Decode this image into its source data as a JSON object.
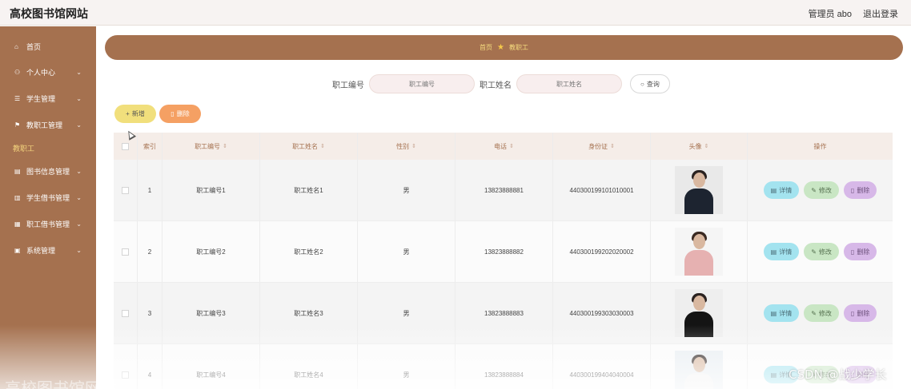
{
  "header": {
    "title": "高校图书馆网站",
    "admin_label": "管理员 abo",
    "logout_label": "退出登录"
  },
  "sidebar": {
    "items": [
      {
        "label": "首页",
        "icon": "home-icon",
        "glyph": "⌂",
        "has_chevron": false
      },
      {
        "label": "个人中心",
        "icon": "user-icon",
        "glyph": "⚇",
        "has_chevron": true
      },
      {
        "label": "学生管理",
        "icon": "student-icon",
        "glyph": "☰",
        "has_chevron": true
      },
      {
        "label": "教职工管理",
        "icon": "staff-icon",
        "glyph": "⚑",
        "has_chevron": true
      },
      {
        "label": "教职工",
        "icon": "",
        "glyph": "",
        "has_chevron": false,
        "active": true
      },
      {
        "label": "图书信息管理",
        "icon": "book-icon",
        "glyph": "▤",
        "has_chevron": true
      },
      {
        "label": "学生借书管理",
        "icon": "bar-chart-icon",
        "glyph": "▥",
        "has_chevron": true
      },
      {
        "label": "职工借书管理",
        "icon": "grid-icon",
        "glyph": "▦",
        "has_chevron": true
      },
      {
        "label": "系统管理",
        "icon": "settings-icon",
        "glyph": "▣",
        "has_chevron": true
      }
    ]
  },
  "breadcrumb": {
    "home": "首页",
    "current": "教职工"
  },
  "search": {
    "field1_label": "职工编号",
    "field1_placeholder": "职工编号",
    "field2_label": "职工姓名",
    "field2_placeholder": "职工姓名",
    "query_label": "查询"
  },
  "toolbar": {
    "add_label": "新增",
    "delete_label": "删除"
  },
  "table": {
    "headers": {
      "index": "索引",
      "employee_no": "职工编号",
      "employee_name": "职工姓名",
      "gender": "性别",
      "phone": "电话",
      "id_card": "身份证",
      "avatar": "头像",
      "actions": "操作"
    },
    "rows": [
      {
        "index": "1",
        "employee_no": "职工编号1",
        "employee_name": "职工姓名1",
        "gender": "男",
        "phone": "13823888881",
        "id_card": "440300199101010001"
      },
      {
        "index": "2",
        "employee_no": "职工编号2",
        "employee_name": "职工姓名2",
        "gender": "男",
        "phone": "13823888882",
        "id_card": "440300199202020002"
      },
      {
        "index": "3",
        "employee_no": "职工编号3",
        "employee_name": "职工姓名3",
        "gender": "男",
        "phone": "13823888883",
        "id_card": "440300199303030003"
      },
      {
        "index": "4",
        "employee_no": "职工编号4",
        "employee_name": "职工姓名4",
        "gender": "男",
        "phone": "13823888884",
        "id_card": "440300199404040004"
      }
    ],
    "row_actions": {
      "detail": "详情",
      "edit": "修改",
      "remove": "删除"
    }
  },
  "watermarks": {
    "bottom_left": "高校图书馆网站",
    "bottom_right": "CSDN @战少学长"
  },
  "colors": {
    "sidebar_bg": "#a5714f",
    "accent_yellow": "#f1df7c",
    "accent_orange": "#f5a063",
    "detail_btn": "#a3e3ef",
    "edit_btn": "#c9e6c4",
    "remove_btn": "#d7b8e8"
  }
}
